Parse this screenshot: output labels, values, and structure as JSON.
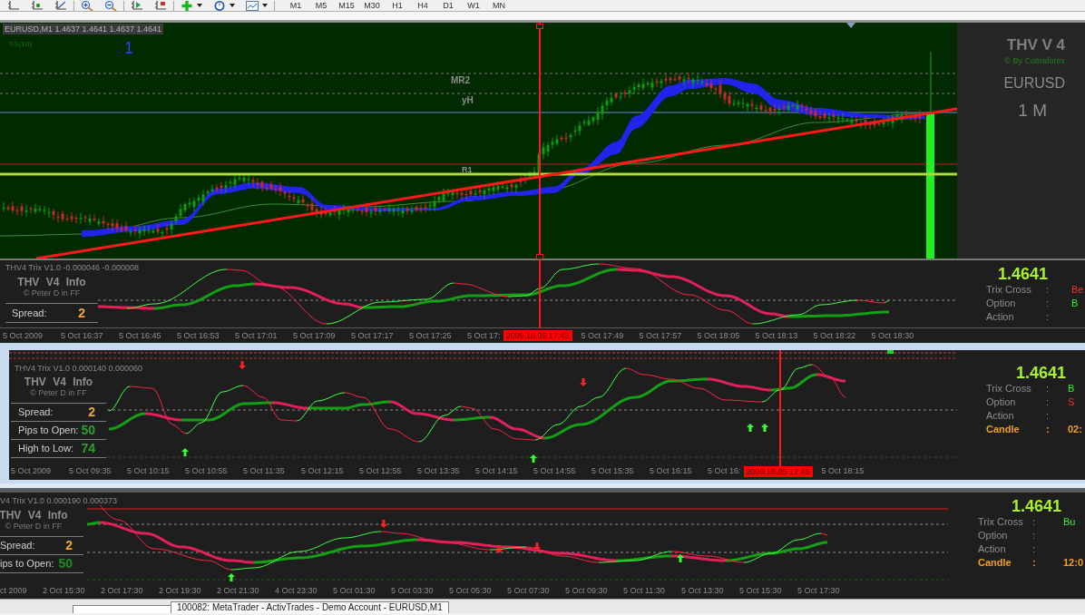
{
  "toolbar": {
    "timeframes": [
      "M1",
      "M5",
      "M15",
      "M30",
      "H1",
      "H4",
      "D1",
      "W1",
      "MN"
    ]
  },
  "chart": {
    "header": "EURUSD,M1 1.4637 1.4641 1.4637 1.4641",
    "indicator_label": "SS(10)",
    "marker": "1",
    "level_labels": [
      "MR2",
      "yH",
      "R1"
    ],
    "brand": {
      "title": "THV V 4",
      "credit": "© By Cobraforex",
      "symbol": "EURUSD",
      "timeframe": "1 M"
    }
  },
  "indicator_windows": [
    {
      "title": "THV4 Trix V1.0 -0.000046 -0.000008",
      "info_title": "THV V4 Info",
      "info_credit": "© Peter D in FF",
      "info_rows": [
        {
          "label": "Spread:",
          "value": "2",
          "color": "#f0a830"
        }
      ],
      "quote": "1.4641",
      "signals": [
        {
          "label": "Trix Cross",
          "separator": ":",
          "value": "Be",
          "color": "#ff2a2a"
        },
        {
          "label": "Option",
          "separator": ":",
          "value": "B",
          "color": "#33ee33"
        },
        {
          "label": "Action",
          "separator": ":"
        }
      ],
      "time_axis": [
        {
          "kind": "tick",
          "text": "5 Oct 2009"
        },
        {
          "kind": "tick",
          "text": "5 Oct 16:37"
        },
        {
          "kind": "tick",
          "text": "5 Oct 16:45"
        },
        {
          "kind": "tick",
          "text": "5 Oct 16:53"
        },
        {
          "kind": "tick",
          "text": "5 Oct 17:01"
        },
        {
          "kind": "tick",
          "text": "5 Oct 17:09"
        },
        {
          "kind": "tick",
          "text": "5 Oct 17:17"
        },
        {
          "kind": "tick",
          "text": "5 Oct 17:25"
        },
        {
          "kind": "tick",
          "text": "5 Oct 17:"
        },
        {
          "kind": "cursor",
          "text": "2009.10.05 17:43"
        },
        {
          "kind": "tick",
          "text": "5 Oct 17:49"
        },
        {
          "kind": "tick",
          "text": "5 Oct 17:57"
        },
        {
          "kind": "tick",
          "text": "5 Oct 18:05"
        },
        {
          "kind": "tick",
          "text": "5 Oct 18:13"
        },
        {
          "kind": "tick",
          "text": "5 Oct 18:22"
        },
        {
          "kind": "tick",
          "text": "5 Oct 18:30"
        }
      ]
    },
    {
      "title": "THV4 Trix V1.0 0.000140 0.000060",
      "info_title": "THV V4 Info",
      "info_credit": "© Peter D in FF",
      "info_rows": [
        {
          "label": "Spread:",
          "value": "2",
          "color": "#f0a830"
        },
        {
          "label": "Pips to Open:",
          "value": "50",
          "color": "#2e9e2e"
        },
        {
          "label": "High to Low:",
          "value": "74",
          "color": "#2e9e2e"
        }
      ],
      "quote": "1.4641",
      "signals": [
        {
          "label": "Trix Cross",
          "separator": ":",
          "value": "B",
          "color": "#33ee33"
        },
        {
          "label": "Option",
          "separator": ":",
          "value": "S",
          "color": "#ff2a2a"
        },
        {
          "label": "Action",
          "separator": ":"
        }
      ],
      "candle": {
        "label": "Candle",
        "separator": ":",
        "value": "02:"
      },
      "time_axis": [
        {
          "kind": "tick",
          "text": "5 Oct 2009"
        },
        {
          "kind": "tick",
          "text": "5 Oct 09:35"
        },
        {
          "kind": "tick",
          "text": "5 Oct 10:15"
        },
        {
          "kind": "tick",
          "text": "5 Oct 10:55"
        },
        {
          "kind": "tick",
          "text": "5 Oct 11:35"
        },
        {
          "kind": "tick",
          "text": "5 Oct 12:15"
        },
        {
          "kind": "tick",
          "text": "5 Oct 12:55"
        },
        {
          "kind": "tick",
          "text": "5 Oct 13:35"
        },
        {
          "kind": "tick",
          "text": "5 Oct 14:15"
        },
        {
          "kind": "tick",
          "text": "5 Oct 14:55"
        },
        {
          "kind": "tick",
          "text": "5 Oct 15:35"
        },
        {
          "kind": "tick",
          "text": "5 Oct 16:15"
        },
        {
          "kind": "tick",
          "text": "5 Oct 16:"
        },
        {
          "kind": "cursor",
          "text": "2009.10.05 17:45"
        },
        {
          "kind": "tick",
          "text": "5 Oct 18:15"
        }
      ]
    },
    {
      "title": "V4 Trix V1.0 0.000190 0.000373",
      "info_title": "THV V4 Info",
      "info_credit": "© Peter D in FF",
      "info_rows": [
        {
          "label": "Spread:",
          "value": "2",
          "color": "#f0a830"
        },
        {
          "label": "ips to Open:",
          "value": "50",
          "color": "#1f8a1f"
        }
      ],
      "quote": "1.4641",
      "signals": [
        {
          "label": "Trix Cross",
          "separator": ":",
          "value": "Bu",
          "color": "#33ee33"
        },
        {
          "label": "Option",
          "separator": ":"
        },
        {
          "label": "Action",
          "separator": ":"
        }
      ],
      "candle": {
        "label": "Candle",
        "separator": ":",
        "value": "12:0"
      },
      "time_axis": [
        {
          "kind": "edge",
          "text": "ct 2009"
        },
        {
          "kind": "tick",
          "text": "2 Oct 15:30"
        },
        {
          "kind": "tick",
          "text": "2 Oct 17:30"
        },
        {
          "kind": "tick",
          "text": "2 Oct 19:30"
        },
        {
          "kind": "tick",
          "text": "2 Oct 21:30"
        },
        {
          "kind": "tick",
          "text": "4 Oct 23:30"
        },
        {
          "kind": "tick",
          "text": "5 Oct 01:30"
        },
        {
          "kind": "tick",
          "text": "5 Oct 03:30"
        },
        {
          "kind": "tick",
          "text": "5 Oct 05:30"
        },
        {
          "kind": "tick",
          "text": "5 Oct 07:30"
        },
        {
          "kind": "tick",
          "text": "5 Oct 09:30"
        },
        {
          "kind": "tick",
          "text": "5 Oct 11:30"
        },
        {
          "kind": "tick",
          "text": "5 Oct 13:30"
        },
        {
          "kind": "tick",
          "text": "5 Oct 15:30"
        },
        {
          "kind": "tick",
          "text": "5 Oct 17:30"
        }
      ]
    }
  ],
  "window_tab": "100082: MetaTrader - ActivTrades - Demo Account - EURUSD,M1"
}
